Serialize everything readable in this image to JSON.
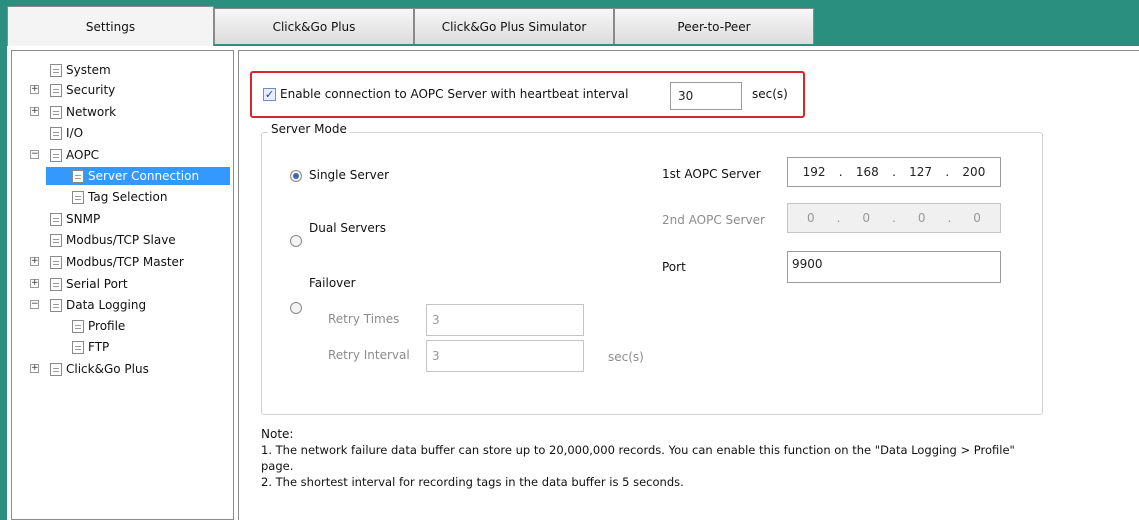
{
  "tabs": [
    "Settings",
    "Click&Go Plus",
    "Click&Go Plus Simulator",
    "Peer-to-Peer"
  ],
  "tree": {
    "system": "System",
    "security": "Security",
    "network": "Network",
    "io": "I/O",
    "aopc": "AOPC",
    "server_connection": "Server Connection",
    "tag_selection": "Tag Selection",
    "snmp": "SNMP",
    "modbus_slave": "Modbus/TCP Slave",
    "modbus_master": "Modbus/TCP Master",
    "serial_port": "Serial Port",
    "data_logging": "Data Logging",
    "profile": "Profile",
    "ftp": "FTP",
    "clickgo_plus": "Click&Go Plus",
    "expand_plus": "+",
    "expand_minus": "−"
  },
  "enable": {
    "checkbox_mark": "✓",
    "label": "Enable connection to AOPC Server with heartbeat interval",
    "interval_value": "30",
    "unit": "sec(s)"
  },
  "server_mode": {
    "legend": "Server Mode",
    "single": "Single Server",
    "dual": "Dual Servers",
    "failover": "Failover",
    "retry_times_label": "Retry Times",
    "retry_times_value": "3",
    "retry_interval_label": "Retry Interval",
    "retry_interval_value": "3",
    "retry_interval_unit": "sec(s)",
    "first_server_label": "1st AOPC Server",
    "first_server_ip": [
      "192",
      "168",
      "127",
      "200"
    ],
    "second_server_label": "2nd AOPC Server",
    "second_server_ip": [
      "0",
      "0",
      "0",
      "0"
    ],
    "port_label": "Port",
    "port_value": "9900",
    "ip_dot": "."
  },
  "note": {
    "title": "Note:",
    "line1": "1. The network failure data buffer can store up to 20,000,000 records. You can enable this function on the \"Data Logging > Profile\"",
    "line1b": "page.",
    "line2": "2. The shortest interval for recording tags in the data buffer is 5 seconds."
  },
  "colors": {
    "frame_teal": "#2a8f7f",
    "selection_blue": "#3399ff",
    "highlight_red": "#d9252d"
  }
}
